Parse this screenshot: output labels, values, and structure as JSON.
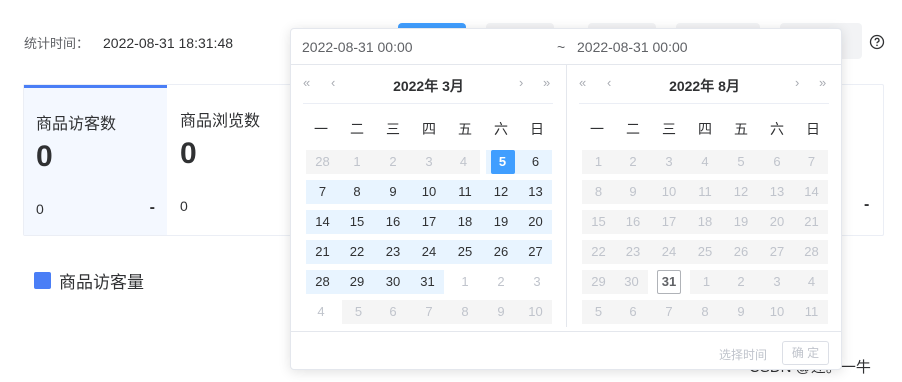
{
  "stats": {
    "time_label": "统计时间：",
    "time_value": "2022-08-31 18:31:48"
  },
  "cards": [
    {
      "title": "商品访客数",
      "value": "0",
      "sub": "0",
      "trend": "-"
    },
    {
      "title": "商品浏览数",
      "value": "0",
      "sub": "0",
      "trend": ""
    }
  ],
  "right_dash": "-",
  "legend": {
    "label": "商品访客量",
    "color": "#4a7ef6"
  },
  "watermark": "CSDN @述。一牛",
  "picker": {
    "start_value": "2022-08-31 00:00",
    "separator": "~",
    "end_value": "2022-08-31 00:00",
    "nav": {
      "double_prev": "«",
      "prev": "‹",
      "next": "›",
      "double_next": "»"
    },
    "weekdays": [
      "一",
      "二",
      "三",
      "四",
      "五",
      "六",
      "日"
    ],
    "left": {
      "title": "2022年 3月",
      "days": [
        {
          "d": "28",
          "s": "disabled"
        },
        {
          "d": "1",
          "s": "disabled"
        },
        {
          "d": "2",
          "s": "disabled"
        },
        {
          "d": "3",
          "s": "disabled"
        },
        {
          "d": "4",
          "s": "disabled"
        },
        {
          "d": "5",
          "s": "selected"
        },
        {
          "d": "6",
          "s": "inrange"
        },
        {
          "d": "7",
          "s": "inrange"
        },
        {
          "d": "8",
          "s": "inrange"
        },
        {
          "d": "9",
          "s": "inrange"
        },
        {
          "d": "10",
          "s": "inrange"
        },
        {
          "d": "11",
          "s": "inrange"
        },
        {
          "d": "12",
          "s": "inrange"
        },
        {
          "d": "13",
          "s": "inrange"
        },
        {
          "d": "14",
          "s": "inrange"
        },
        {
          "d": "15",
          "s": "inrange"
        },
        {
          "d": "16",
          "s": "inrange"
        },
        {
          "d": "17",
          "s": "inrange"
        },
        {
          "d": "18",
          "s": "inrange"
        },
        {
          "d": "19",
          "s": "inrange"
        },
        {
          "d": "20",
          "s": "inrange"
        },
        {
          "d": "21",
          "s": "inrange"
        },
        {
          "d": "22",
          "s": "inrange"
        },
        {
          "d": "23",
          "s": "inrange"
        },
        {
          "d": "24",
          "s": "inrange"
        },
        {
          "d": "25",
          "s": "inrange"
        },
        {
          "d": "26",
          "s": "inrange"
        },
        {
          "d": "27",
          "s": "inrange"
        },
        {
          "d": "28",
          "s": "inrange"
        },
        {
          "d": "29",
          "s": "inrange"
        },
        {
          "d": "30",
          "s": "inrange"
        },
        {
          "d": "31",
          "s": "inrange"
        },
        {
          "d": "1",
          "s": "prevnext"
        },
        {
          "d": "2",
          "s": "prevnext"
        },
        {
          "d": "3",
          "s": "prevnext"
        },
        {
          "d": "4",
          "s": "prevnext"
        },
        {
          "d": "5",
          "s": "disabled"
        },
        {
          "d": "6",
          "s": "disabled"
        },
        {
          "d": "7",
          "s": "disabled"
        },
        {
          "d": "8",
          "s": "disabled"
        },
        {
          "d": "9",
          "s": "disabled"
        },
        {
          "d": "10",
          "s": "disabled"
        }
      ]
    },
    "right": {
      "title": "2022年 8月",
      "days": [
        {
          "d": "1",
          "s": "disabled"
        },
        {
          "d": "2",
          "s": "disabled"
        },
        {
          "d": "3",
          "s": "disabled"
        },
        {
          "d": "4",
          "s": "disabled"
        },
        {
          "d": "5",
          "s": "disabled"
        },
        {
          "d": "6",
          "s": "disabled"
        },
        {
          "d": "7",
          "s": "disabled"
        },
        {
          "d": "8",
          "s": "disabled"
        },
        {
          "d": "9",
          "s": "disabled"
        },
        {
          "d": "10",
          "s": "disabled"
        },
        {
          "d": "11",
          "s": "disabled"
        },
        {
          "d": "12",
          "s": "disabled"
        },
        {
          "d": "13",
          "s": "disabled"
        },
        {
          "d": "14",
          "s": "disabled"
        },
        {
          "d": "15",
          "s": "disabled"
        },
        {
          "d": "16",
          "s": "disabled"
        },
        {
          "d": "17",
          "s": "disabled"
        },
        {
          "d": "18",
          "s": "disabled"
        },
        {
          "d": "19",
          "s": "disabled"
        },
        {
          "d": "20",
          "s": "disabled"
        },
        {
          "d": "21",
          "s": "disabled"
        },
        {
          "d": "22",
          "s": "disabled"
        },
        {
          "d": "23",
          "s": "disabled"
        },
        {
          "d": "24",
          "s": "disabled"
        },
        {
          "d": "25",
          "s": "disabled"
        },
        {
          "d": "26",
          "s": "disabled"
        },
        {
          "d": "27",
          "s": "disabled"
        },
        {
          "d": "28",
          "s": "disabled"
        },
        {
          "d": "29",
          "s": "disabled"
        },
        {
          "d": "30",
          "s": "disabled"
        },
        {
          "d": "31",
          "s": "today"
        },
        {
          "d": "1",
          "s": "disabled"
        },
        {
          "d": "2",
          "s": "disabled"
        },
        {
          "d": "3",
          "s": "disabled"
        },
        {
          "d": "4",
          "s": "disabled"
        },
        {
          "d": "5",
          "s": "disabled"
        },
        {
          "d": "6",
          "s": "disabled"
        },
        {
          "d": "7",
          "s": "disabled"
        },
        {
          "d": "8",
          "s": "disabled"
        },
        {
          "d": "9",
          "s": "disabled"
        },
        {
          "d": "10",
          "s": "disabled"
        },
        {
          "d": "11",
          "s": "disabled"
        }
      ]
    },
    "footer": {
      "choose_time": "选择时间",
      "ok": "确 定"
    }
  }
}
